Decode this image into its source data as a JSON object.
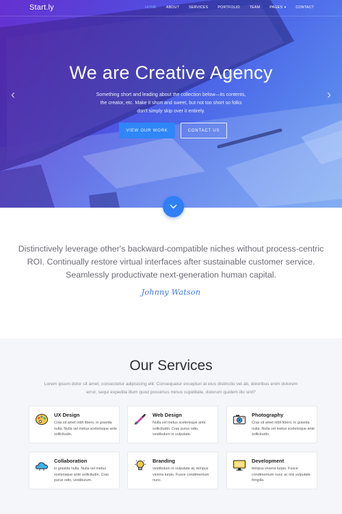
{
  "brand": "Start.ly",
  "nav": {
    "items": [
      "Home",
      "About",
      "Services",
      "Portfolio",
      "Team",
      "Pages",
      "Contact"
    ],
    "active": "Home"
  },
  "hero": {
    "title": "We are Creative Agency",
    "lines": [
      "Something short and leading about the collection below—its contents,",
      "the creator, etc. Make it short and sweet, but not too short so folks",
      "don't simply skip over it entirely."
    ],
    "primary_button": "View our work",
    "secondary_button": "Contact us"
  },
  "quote": {
    "lines": [
      "Distinctively leverage other's backward-compatible niches without process-centric",
      "ROI. Continually restore virtual interfaces after sustainable customer service.",
      "Seamlessly productivate next-generation human capital."
    ],
    "signature": "Johnny Watson"
  },
  "services": {
    "title": "Our Services",
    "subtitle": [
      "Lorem ipsum dolor sit amet, consectetur adipisicing elit. Consequatur excepturi at eius distinctio vel ab, doloribus enim dolorem",
      "error, sequi expedita illum quod possimus minus cupiditate, dolorum quidem illo sint?"
    ],
    "cards": [
      {
        "title": "UX Design",
        "icon": "palette-icon",
        "desc": "Cras sit amet nibh libero, in gravida nulla. Nulla vel metus scelerisque ante sollicitudin."
      },
      {
        "title": "Web Design",
        "icon": "brush-icon",
        "desc": "Nulla vel metus scelerisque ante sollicitudin. Cras purus odio, vestibulum in vulputate."
      },
      {
        "title": "Photography",
        "icon": "camera-icon",
        "desc": "Cras sit amet nibh libero, in gravida nulla. Nulla vel metus scelerisque ante sollicitudin."
      },
      {
        "title": "Collaboration",
        "icon": "cloud-icon",
        "desc": "in gravida nulla. Nulla vel metus scelerisque ante sollicitudin. Cras purus odio, vestibulum."
      },
      {
        "title": "Branding",
        "icon": "lightbulb-icon",
        "desc": "vestibulum in vulputate at, tempus viverra turpis. Fusce condimentum nunc."
      },
      {
        "title": "Development",
        "icon": "monitor-icon",
        "desc": "tempus viverra turpis. Fusce condimentum nunc ac nisi vulputate fringilla."
      }
    ]
  },
  "colors": {
    "accent": "#2f86f6",
    "hero_gradient_start": "#5b3bd9",
    "hero_gradient_end": "#6a9ef2",
    "section_bg": "#f5f6f9"
  }
}
